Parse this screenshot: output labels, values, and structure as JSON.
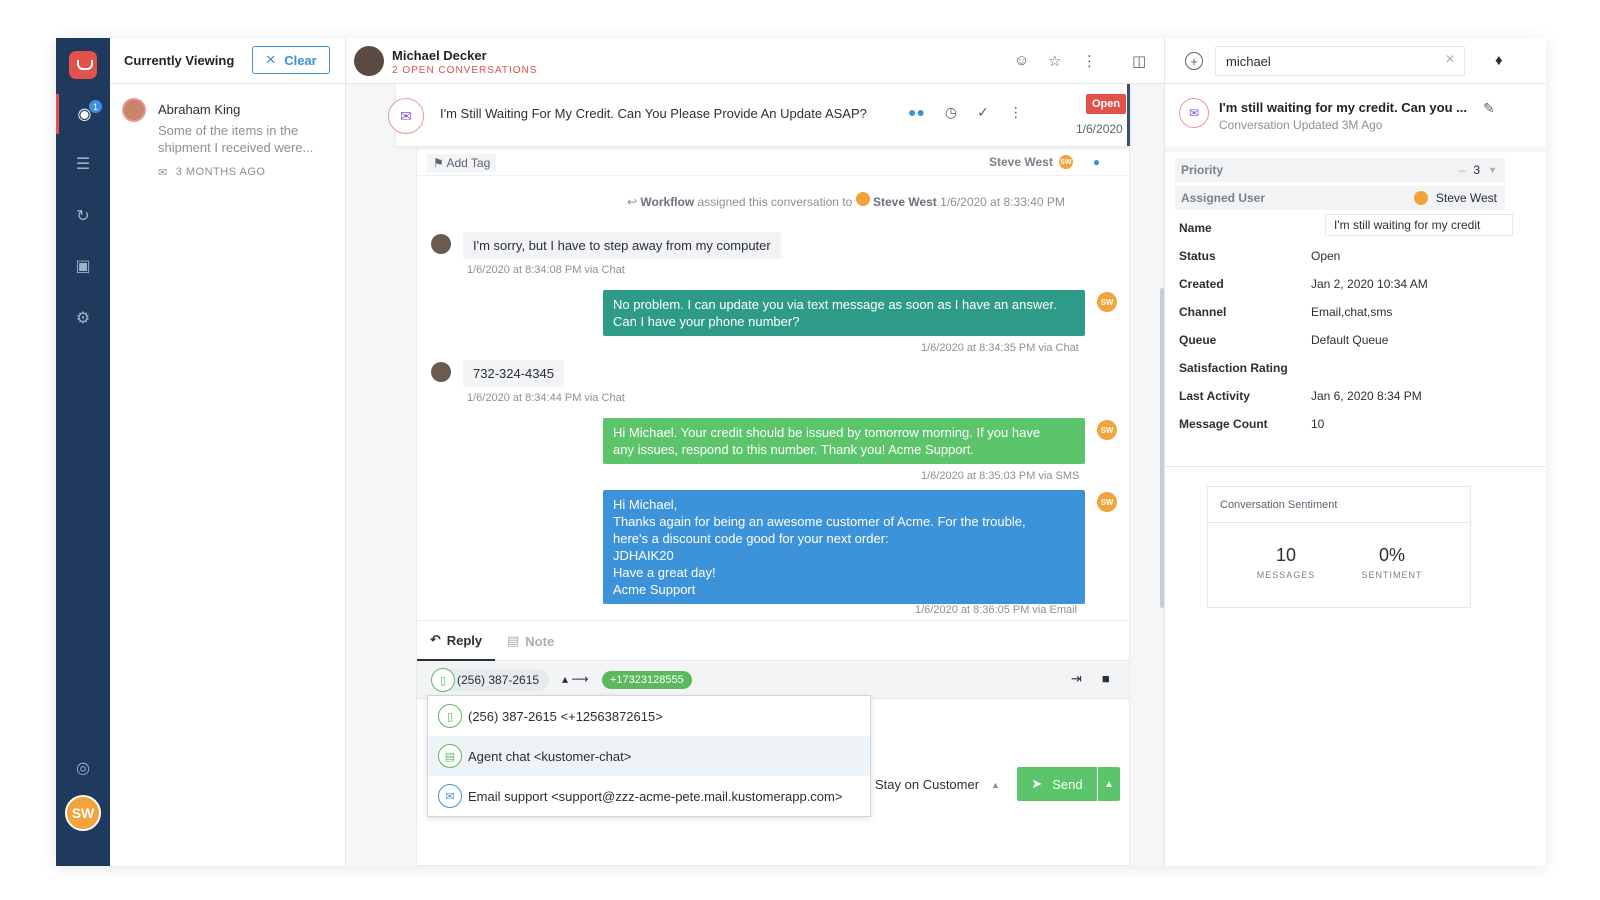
{
  "nav": {
    "badge_count": "1",
    "avatar_initials": "SW",
    "items": [
      {
        "name": "eye-icon",
        "glyph": "◉"
      },
      {
        "name": "search-list-icon",
        "glyph": "☰"
      },
      {
        "name": "refresh-icon",
        "glyph": "↻"
      },
      {
        "name": "image-icon",
        "glyph": "▣"
      },
      {
        "name": "gear-icon",
        "glyph": "⚙"
      },
      {
        "name": "globe-icon",
        "glyph": "◎"
      }
    ]
  },
  "viewing": {
    "title": "Currently Viewing",
    "clear_label": "Clear",
    "card": {
      "name": "Abraham King",
      "preview": "Some of the items in the shipment I received were...",
      "time": "3 MONTHS AGO"
    }
  },
  "header": {
    "customer_name": "Michael Decker",
    "open_conversations": "2 OPEN CONVERSATIONS"
  },
  "conversation": {
    "title": "I'm Still Waiting For My Credit. Can You Please Provide An Update ASAP?",
    "status": "Open",
    "date": "1/6/2020",
    "add_tag": "Add Tag",
    "assigned_to": "Steve West",
    "workflow": {
      "actor": "Workflow",
      "text": "assigned this conversation to",
      "assignee": "Steve West",
      "time": "1/6/2020 at 8:33:40 PM"
    },
    "messages": [
      {
        "direction": "in",
        "text": "I'm sorry, but I have to step away from my computer",
        "meta": "1/6/2020 at 8:34:08 PM via Chat"
      },
      {
        "direction": "out",
        "color": "#2e9a88",
        "lines": [
          "No problem. I can update you via text message as soon as I have an answer.",
          "Can I have your phone number?"
        ],
        "meta": "1/6/2020 at 8:34:35 PM via Chat"
      },
      {
        "direction": "in",
        "text": "732-324-4345",
        "meta": "1/6/2020 at 8:34:44 PM via Chat"
      },
      {
        "direction": "out",
        "color": "#5cc46a",
        "lines": [
          "Hi Michael. Your credit should be issued by tomorrow morning. If you have",
          "any issues, respond to this number. Thank you! Acme Support."
        ],
        "meta": "1/6/2020 at 8:35:03 PM via SMS"
      },
      {
        "direction": "out",
        "color": "#3d93da",
        "lines": [
          "Hi Michael,",
          "Thanks again for being an awesome customer of Acme. For the trouble,",
          "here's a discount code good for your next order:",
          "JDHAIK20",
          "Have a great day!",
          "Acme Support"
        ],
        "meta": "1/6/2020 at 8:36:05 PM via Email"
      }
    ]
  },
  "reply": {
    "tab_reply": "Reply",
    "tab_note": "Note",
    "from_number": "(256) 387-2615",
    "to_number": "+17323128555",
    "stay_label": "Stay on Customer",
    "send_label": "Send",
    "dropdown": [
      {
        "label": "(256) 387-2615 <+12563872615>",
        "color": "#5cb85c",
        "glyph": "▯"
      },
      {
        "label": "Agent chat <kustomer-chat>",
        "color": "#5cb85c",
        "glyph": "▤"
      },
      {
        "label": "Email support <support@zzz-acme-pete.mail.kustomerapp.com>",
        "color": "#3d93da",
        "glyph": "✉"
      }
    ]
  },
  "panel": {
    "search_value": "michael",
    "conv_title": "I'm still waiting for my credit. Can you ...",
    "conv_updated": "Conversation Updated 3M Ago",
    "priority_label": "Priority",
    "priority_value": "3",
    "assigned_label": "Assigned User",
    "assigned_value": "Steve West",
    "fields": [
      {
        "key": "Name",
        "value": "I'm still waiting for my credit"
      },
      {
        "key": "Status",
        "value": "Open"
      },
      {
        "key": "Created",
        "value": "Jan 2, 2020 10:34 AM"
      },
      {
        "key": "Channel",
        "value": "Email,chat,sms"
      },
      {
        "key": "Queue",
        "value": "Default Queue"
      },
      {
        "key": "Satisfaction Rating",
        "value": ""
      },
      {
        "key": "Last Activity",
        "value": "Jan 6, 2020 8:34 PM"
      },
      {
        "key": "Message Count",
        "value": "10"
      }
    ],
    "sentiment": {
      "title": "Conversation Sentiment",
      "messages_value": "10",
      "messages_label": "MESSAGES",
      "sentiment_value": "0%",
      "sentiment_label": "SENTIMENT"
    }
  }
}
